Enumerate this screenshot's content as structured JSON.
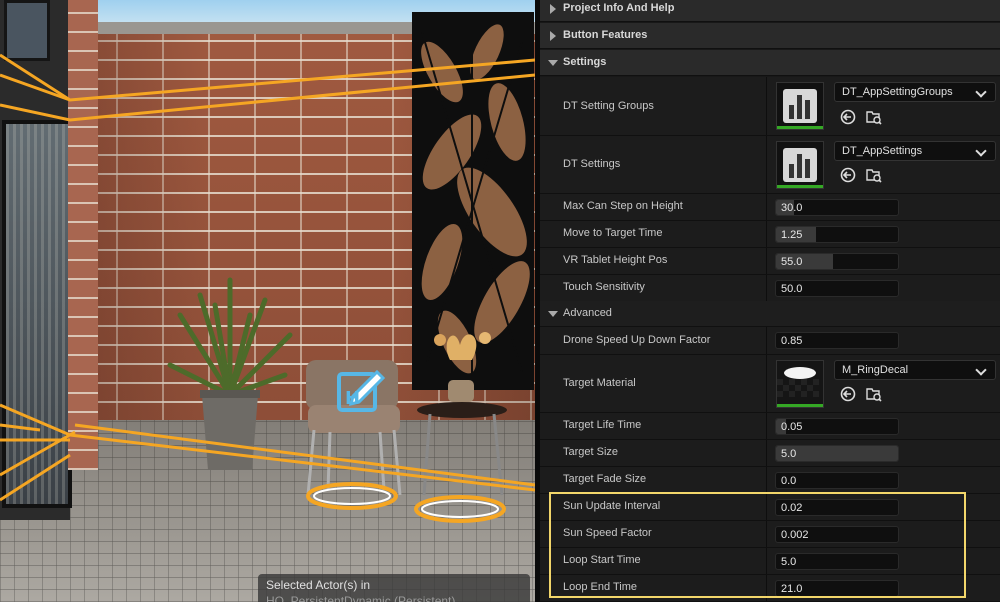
{
  "viewport": {
    "toast": {
      "line1": "Selected Actor(s) in",
      "line2": "HQ_PersistentDynamic (Persistent)"
    },
    "edit_icon": "edit-icon"
  },
  "details": {
    "categories": [
      {
        "label": "Project Info And Help",
        "expanded": false
      },
      {
        "label": "Button Features",
        "expanded": false
      },
      {
        "label": "Settings",
        "expanded": true
      }
    ],
    "assets": {
      "dt_setting_groups": {
        "label": "DT Setting Groups",
        "value": "DT_AppSettingGroups"
      },
      "dt_settings": {
        "label": "DT Settings",
        "value": "DT_AppSettings"
      },
      "target_material": {
        "label": "Target Material",
        "value": "M_RingDecal"
      }
    },
    "props": {
      "max_can_step": {
        "label": "Max Can Step on Height",
        "value": "30.0",
        "fill": 0.15
      },
      "move_to_target": {
        "label": "Move to Target Time",
        "value": "1.25",
        "fill": 0.33
      },
      "vr_tablet_height": {
        "label": "VR Tablet Height Pos",
        "value": "55.0",
        "fill": 0.47
      },
      "touch_sensitivity": {
        "label": "Touch Sensitivity",
        "value": "50.0",
        "fill": 0
      },
      "drone_speed": {
        "label": "Drone Speed Up Down Factor",
        "value": "0.85",
        "fill": 0
      },
      "target_life_time": {
        "label": "Target Life Time",
        "value": "0.05",
        "fill": 0.08
      },
      "target_size": {
        "label": "Target Size",
        "value": "5.0",
        "fill": 1.0
      },
      "target_fade_size": {
        "label": "Target Fade Size",
        "value": "0.0",
        "fill": 0
      },
      "sun_update_interval": {
        "label": "Sun Update Interval",
        "value": "0.02",
        "fill": 0
      },
      "sun_speed_factor": {
        "label": "Sun Speed Factor",
        "value": "0.002",
        "fill": 0
      },
      "loop_start_time": {
        "label": "Loop Start Time",
        "value": "5.0",
        "fill": 0
      },
      "loop_end_time": {
        "label": "Loop End Time",
        "value": "21.0",
        "fill": 0
      }
    },
    "advanced_label": "Advanced"
  },
  "colors": {
    "highlight": "#f2d66a",
    "selection_outline": "#f5a623",
    "asset_ok_bar": "#35a825",
    "panel_bg": "#181818"
  }
}
